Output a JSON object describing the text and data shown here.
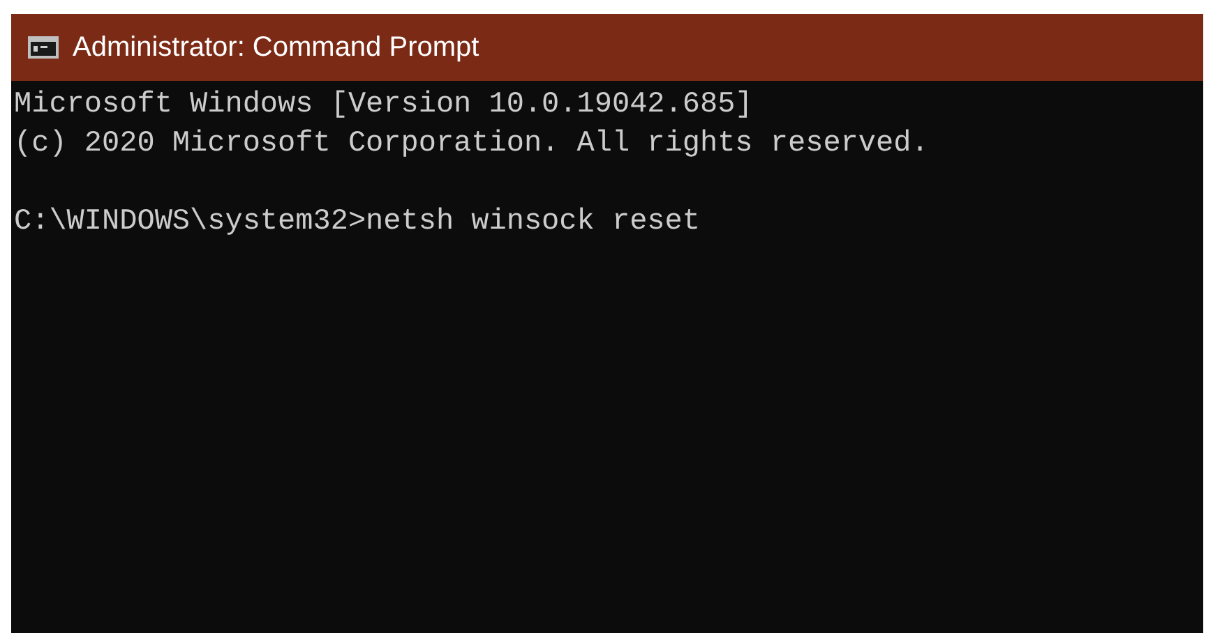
{
  "window": {
    "title": "Administrator: Command Prompt"
  },
  "console": {
    "blocks": [
      [
        "Microsoft Windows [Version 10.0.19042.685]",
        "(c) 2020 Microsoft Corporation. All rights reserved."
      ],
      [
        "C:\\WINDOWS\\system32>netsh winsock reset"
      ]
    ]
  }
}
